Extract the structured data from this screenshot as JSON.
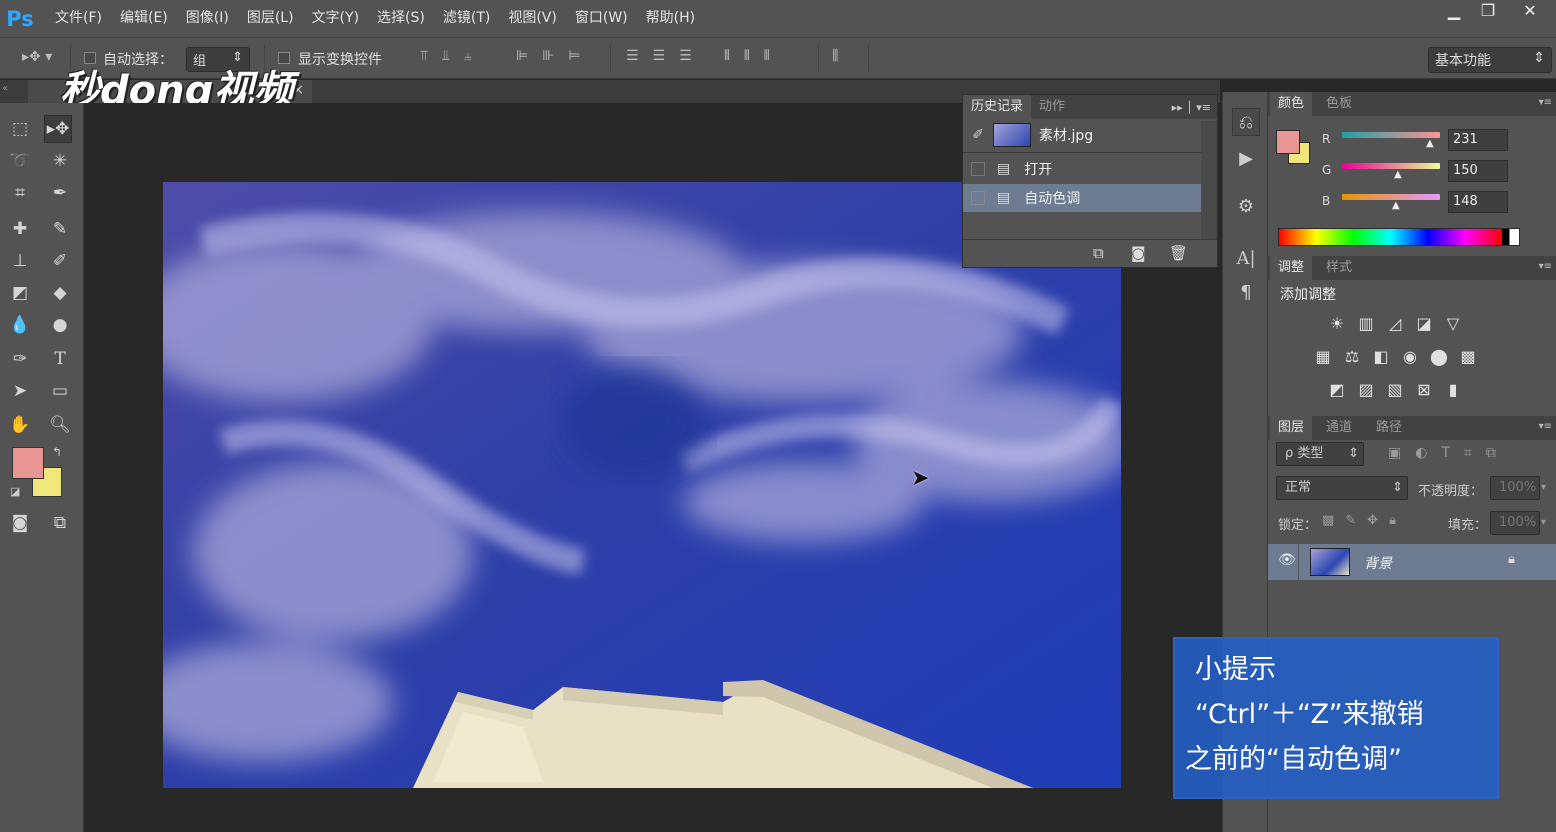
{
  "app": {
    "logo": "Ps"
  },
  "menu": [
    "文件(F)",
    "编辑(E)",
    "图像(I)",
    "图层(L)",
    "文字(Y)",
    "选择(S)",
    "滤镜(T)",
    "视图(V)",
    "窗口(W)",
    "帮助(H)"
  ],
  "window_controls": {
    "minimize": "▁",
    "restore": "❐",
    "close": "✕"
  },
  "options": {
    "auto_select_label": "自动选择：",
    "auto_select_value": "组",
    "show_transform_label": "显示变换控件",
    "workspace": "基本功能"
  },
  "watermark": "秒dong视频",
  "doc_tab": {
    "close": "×"
  },
  "history": {
    "tabs": [
      "历史记录",
      "动作"
    ],
    "snapshot": "素材.jpg",
    "items": [
      "打开",
      "自动色调"
    ]
  },
  "color": {
    "tabs": [
      "颜色",
      "色板"
    ],
    "channels": [
      {
        "label": "R",
        "value": "231"
      },
      {
        "label": "G",
        "value": "150"
      },
      {
        "label": "B",
        "value": "148"
      }
    ],
    "foreground": "#e79694",
    "background": "#f0e67a"
  },
  "adjustments": {
    "tabs": [
      "调整",
      "样式"
    ],
    "title": "添加调整"
  },
  "layers": {
    "tabs": [
      "图层",
      "通道",
      "路径"
    ],
    "filter": "ρ 类型",
    "blend": "正常",
    "opacity_label": "不透明度：",
    "opacity": "100%",
    "lock_label": "锁定：",
    "fill_label": "填充：",
    "fill": "100%",
    "layer_name": "背景"
  },
  "tip": {
    "title": "小提示",
    "line1": "“Ctrl”＋“Z”来撤销",
    "line2": "之前的“自动色调”"
  }
}
